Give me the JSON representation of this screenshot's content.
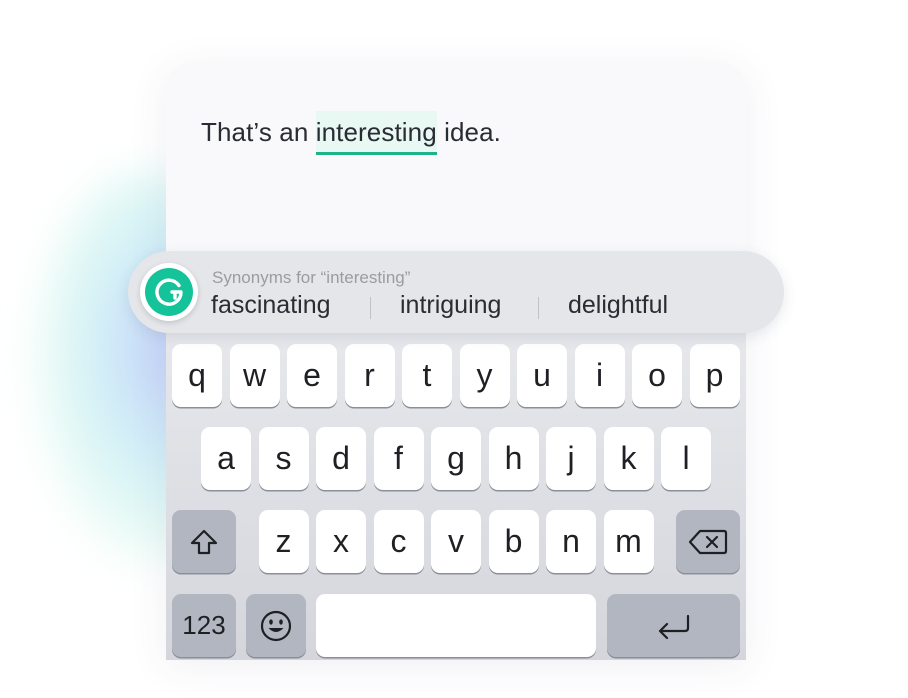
{
  "editor": {
    "text_before": "That’s an ",
    "highlighted_word": "interesting",
    "text_after": " idea."
  },
  "suggestion_bar": {
    "heading": "Synonyms for “interesting”",
    "synonyms": [
      "fascinating",
      "intriguing",
      "delightful"
    ],
    "logo_icon": "grammarly-g-icon",
    "accent_color": "#15c39a"
  },
  "keyboard": {
    "row1": [
      "q",
      "w",
      "e",
      "r",
      "t",
      "y",
      "u",
      "i",
      "o",
      "p"
    ],
    "row2": [
      "a",
      "s",
      "d",
      "f",
      "g",
      "h",
      "j",
      "k",
      "l"
    ],
    "row3": [
      "z",
      "x",
      "c",
      "v",
      "b",
      "n",
      "m"
    ],
    "shift_icon": "shift-icon",
    "backspace_icon": "backspace-icon",
    "numbers_label": "123",
    "emoji_icon": "emoji-icon",
    "return_icon": "return-icon"
  }
}
